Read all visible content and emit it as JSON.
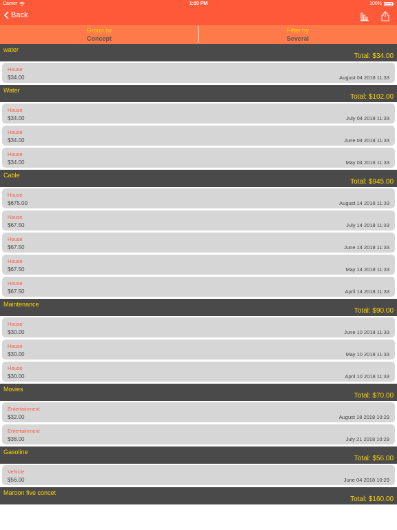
{
  "status_bar": {
    "carrier": "Carrier",
    "time": "1:00 PM",
    "battery": "100%"
  },
  "nav": {
    "back_label": "Back"
  },
  "segments": [
    {
      "title": "Group by",
      "value": "Concept"
    },
    {
      "title": "Filter by",
      "value": "Several"
    }
  ],
  "groups": [
    {
      "name": "water",
      "total": "Total: $34.00",
      "rows": [
        {
          "category": "House",
          "amount": "$34.00",
          "date": "August 04 2018 11:33"
        }
      ]
    },
    {
      "name": "Water",
      "total": "Total: $102.00",
      "rows": [
        {
          "category": "House",
          "amount": "$34.00",
          "date": "July 04 2018 11:33"
        },
        {
          "category": "House",
          "amount": "$34.00",
          "date": "June 04 2018 11:33"
        },
        {
          "category": "House",
          "amount": "$34.00",
          "date": "May 04 2018 11:33"
        }
      ]
    },
    {
      "name": "Cable",
      "total": "Total: $945.00",
      "rows": [
        {
          "category": "House",
          "amount": "$675.00",
          "date": "August 14 2018 11:33"
        },
        {
          "category": "House",
          "amount": "$67.50",
          "date": "July 14 2018 11:33"
        },
        {
          "category": "House",
          "amount": "$67.50",
          "date": "June 14 2018 11:33"
        },
        {
          "category": "House",
          "amount": "$67.50",
          "date": "May 14 2018 11:33"
        },
        {
          "category": "House",
          "amount": "$67.50",
          "date": "April 14 2018 11:33"
        }
      ]
    },
    {
      "name": "Maintenance",
      "total": "Total: $90.00",
      "rows": [
        {
          "category": "House",
          "amount": "$30.00",
          "date": "June 10 2018 11:33"
        },
        {
          "category": "House",
          "amount": "$30.00",
          "date": "May 10 2018 11:33"
        },
        {
          "category": "House",
          "amount": "$30.00",
          "date": "April 10 2018 11:33"
        }
      ]
    },
    {
      "name": "Movies",
      "total": "Total: $70.00",
      "rows": [
        {
          "category": "Entertainment",
          "amount": "$32.00",
          "date": "August 18 2018 10:29"
        },
        {
          "category": "Entertainment",
          "amount": "$38.00",
          "date": "July 21 2018 10:29"
        }
      ]
    },
    {
      "name": "Gasoline",
      "total": "Total: $56.00",
      "rows": [
        {
          "category": "Vehicle",
          "amount": "$56.00",
          "date": "June 04 2018 10:29"
        }
      ]
    },
    {
      "name": "Maroon five concet",
      "total": "Total: $160.00",
      "rows": []
    }
  ],
  "colors": {
    "accent": "#fe5a3a",
    "segment_bg": "#fe7a4a",
    "header_bg": "#4a4a4a",
    "highlight": "#ffd400",
    "row_bg": "#d6d6d6"
  }
}
